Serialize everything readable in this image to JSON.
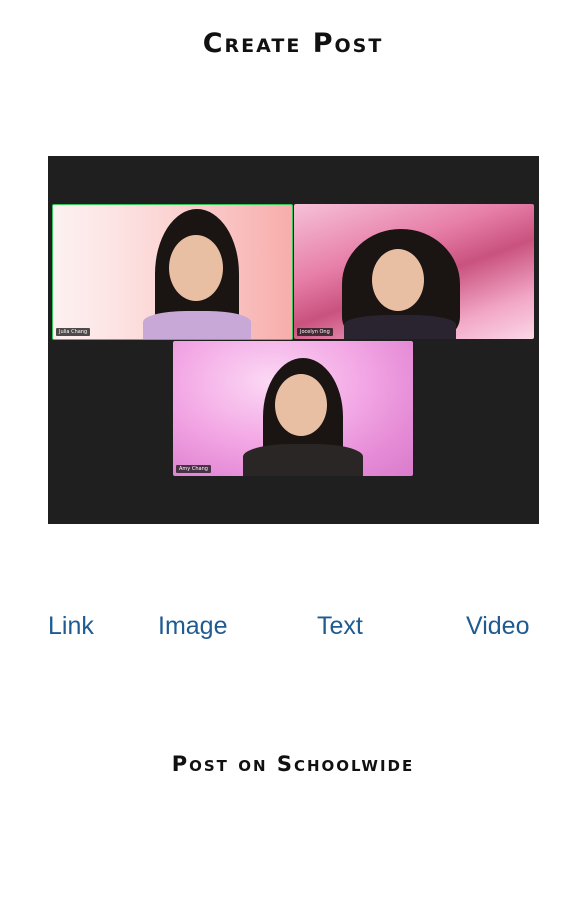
{
  "header": {
    "title": "Create Post"
  },
  "media": {
    "participants": [
      {
        "name": "Julia Chang"
      },
      {
        "name": "Jocelyn Ong"
      },
      {
        "name": "Amy Chang"
      }
    ]
  },
  "tabs": [
    {
      "label": "Link"
    },
    {
      "label": "Image"
    },
    {
      "label": "Text"
    },
    {
      "label": "Video"
    }
  ],
  "actions": {
    "post_label": "Post on Schoolwide"
  },
  "colors": {
    "tab_text": "#1e5b92",
    "title_text": "#111111",
    "active_speaker_border": "#35c759",
    "media_background": "#1f1f1f"
  }
}
